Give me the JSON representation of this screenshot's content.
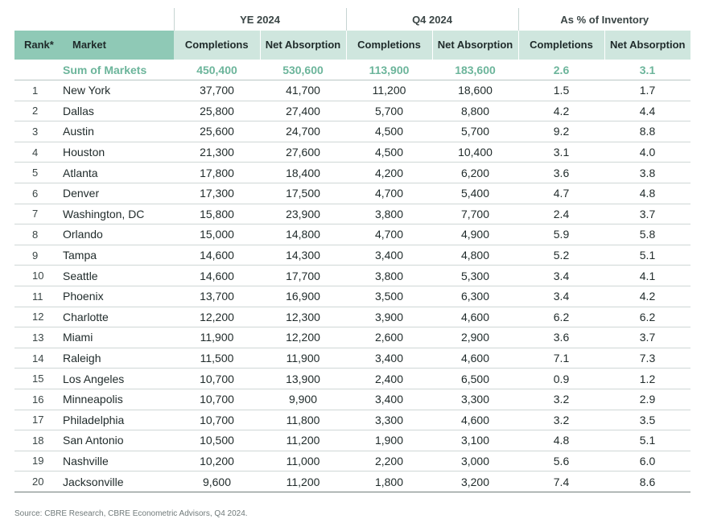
{
  "header": {
    "groups": {
      "ye2024": "YE 2024",
      "q42024": "Q4 2024",
      "pct_inventory": "As % of Inventory"
    },
    "columns": {
      "rank": "Rank*",
      "market": "Market",
      "ye_completions": "Completions",
      "ye_net_absorption": "Net Absorption",
      "q4_completions": "Completions",
      "q4_net_absorption": "Net Absorption",
      "pct_completions": "Completions",
      "pct_net_absorption": "Net Absorption"
    }
  },
  "sum_row": {
    "label": "Sum of Markets",
    "ye_completions": "450,400",
    "ye_net_absorption": "530,600",
    "q4_completions": "113,900",
    "q4_net_absorption": "183,600",
    "pct_completions": "2.6",
    "pct_net_absorption": "3.1"
  },
  "rows": [
    {
      "rank": "1",
      "market": "New York",
      "ye_completions": "37,700",
      "ye_net_absorption": "41,700",
      "q4_completions": "11,200",
      "q4_net_absorption": "18,600",
      "pct_completions": "1.5",
      "pct_net_absorption": "1.7"
    },
    {
      "rank": "2",
      "market": "Dallas",
      "ye_completions": "25,800",
      "ye_net_absorption": "27,400",
      "q4_completions": "5,700",
      "q4_net_absorption": "8,800",
      "pct_completions": "4.2",
      "pct_net_absorption": "4.4"
    },
    {
      "rank": "3",
      "market": "Austin",
      "ye_completions": "25,600",
      "ye_net_absorption": "24,700",
      "q4_completions": "4,500",
      "q4_net_absorption": "5,700",
      "pct_completions": "9.2",
      "pct_net_absorption": "8.8"
    },
    {
      "rank": "4",
      "market": "Houston",
      "ye_completions": "21,300",
      "ye_net_absorption": "27,600",
      "q4_completions": "4,500",
      "q4_net_absorption": "10,400",
      "pct_completions": "3.1",
      "pct_net_absorption": "4.0"
    },
    {
      "rank": "5",
      "market": "Atlanta",
      "ye_completions": "17,800",
      "ye_net_absorption": "18,400",
      "q4_completions": "4,200",
      "q4_net_absorption": "6,200",
      "pct_completions": "3.6",
      "pct_net_absorption": "3.8"
    },
    {
      "rank": "6",
      "market": "Denver",
      "ye_completions": "17,300",
      "ye_net_absorption": "17,500",
      "q4_completions": "4,700",
      "q4_net_absorption": "5,400",
      "pct_completions": "4.7",
      "pct_net_absorption": "4.8"
    },
    {
      "rank": "7",
      "market": "Washington, DC",
      "ye_completions": "15,800",
      "ye_net_absorption": "23,900",
      "q4_completions": "3,800",
      "q4_net_absorption": "7,700",
      "pct_completions": "2.4",
      "pct_net_absorption": "3.7"
    },
    {
      "rank": "8",
      "market": "Orlando",
      "ye_completions": "15,000",
      "ye_net_absorption": "14,800",
      "q4_completions": "4,700",
      "q4_net_absorption": "4,900",
      "pct_completions": "5.9",
      "pct_net_absorption": "5.8"
    },
    {
      "rank": "9",
      "market": "Tampa",
      "ye_completions": "14,600",
      "ye_net_absorption": "14,300",
      "q4_completions": "3,400",
      "q4_net_absorption": "4,800",
      "pct_completions": "5.2",
      "pct_net_absorption": "5.1"
    },
    {
      "rank": "10",
      "market": "Seattle",
      "ye_completions": "14,600",
      "ye_net_absorption": "17,700",
      "q4_completions": "3,800",
      "q4_net_absorption": "5,300",
      "pct_completions": "3.4",
      "pct_net_absorption": "4.1"
    },
    {
      "rank": "11",
      "market": "Phoenix",
      "ye_completions": "13,700",
      "ye_net_absorption": "16,900",
      "q4_completions": "3,500",
      "q4_net_absorption": "6,300",
      "pct_completions": "3.4",
      "pct_net_absorption": "4.2"
    },
    {
      "rank": "12",
      "market": "Charlotte",
      "ye_completions": "12,200",
      "ye_net_absorption": "12,300",
      "q4_completions": "3,900",
      "q4_net_absorption": "4,600",
      "pct_completions": "6.2",
      "pct_net_absorption": "6.2"
    },
    {
      "rank": "13",
      "market": "Miami",
      "ye_completions": "11,900",
      "ye_net_absorption": "12,200",
      "q4_completions": "2,600",
      "q4_net_absorption": "2,900",
      "pct_completions": "3.6",
      "pct_net_absorption": "3.7"
    },
    {
      "rank": "14",
      "market": "Raleigh",
      "ye_completions": "11,500",
      "ye_net_absorption": "11,900",
      "q4_completions": "3,400",
      "q4_net_absorption": "4,600",
      "pct_completions": "7.1",
      "pct_net_absorption": "7.3"
    },
    {
      "rank": "15",
      "market": "Los Angeles",
      "ye_completions": "10,700",
      "ye_net_absorption": "13,900",
      "q4_completions": "2,400",
      "q4_net_absorption": "6,500",
      "pct_completions": "0.9",
      "pct_net_absorption": "1.2"
    },
    {
      "rank": "16",
      "market": "Minneapolis",
      "ye_completions": "10,700",
      "ye_net_absorption": "9,900",
      "q4_completions": "3,400",
      "q4_net_absorption": "3,300",
      "pct_completions": "3.2",
      "pct_net_absorption": "2.9"
    },
    {
      "rank": "17",
      "market": "Philadelphia",
      "ye_completions": "10,700",
      "ye_net_absorption": "11,800",
      "q4_completions": "3,300",
      "q4_net_absorption": "4,600",
      "pct_completions": "3.2",
      "pct_net_absorption": "3.5"
    },
    {
      "rank": "18",
      "market": "San Antonio",
      "ye_completions": "10,500",
      "ye_net_absorption": "11,200",
      "q4_completions": "1,900",
      "q4_net_absorption": "3,100",
      "pct_completions": "4.8",
      "pct_net_absorption": "5.1"
    },
    {
      "rank": "19",
      "market": "Nashville",
      "ye_completions": "10,200",
      "ye_net_absorption": "11,000",
      "q4_completions": "2,200",
      "q4_net_absorption": "3,000",
      "pct_completions": "5.6",
      "pct_net_absorption": "6.0"
    },
    {
      "rank": "20",
      "market": "Jacksonville",
      "ye_completions": "9,600",
      "ye_net_absorption": "11,200",
      "q4_completions": "1,800",
      "q4_net_absorption": "3,200",
      "pct_completions": "7.4",
      "pct_net_absorption": "8.6"
    }
  ],
  "source": "Source: CBRE Research, CBRE Econometric Advisors, Q4 2024.",
  "colors": {
    "header_dark": "#8fc9b6",
    "header_light": "#cfe6de",
    "sum_text": "#6cb59b"
  }
}
